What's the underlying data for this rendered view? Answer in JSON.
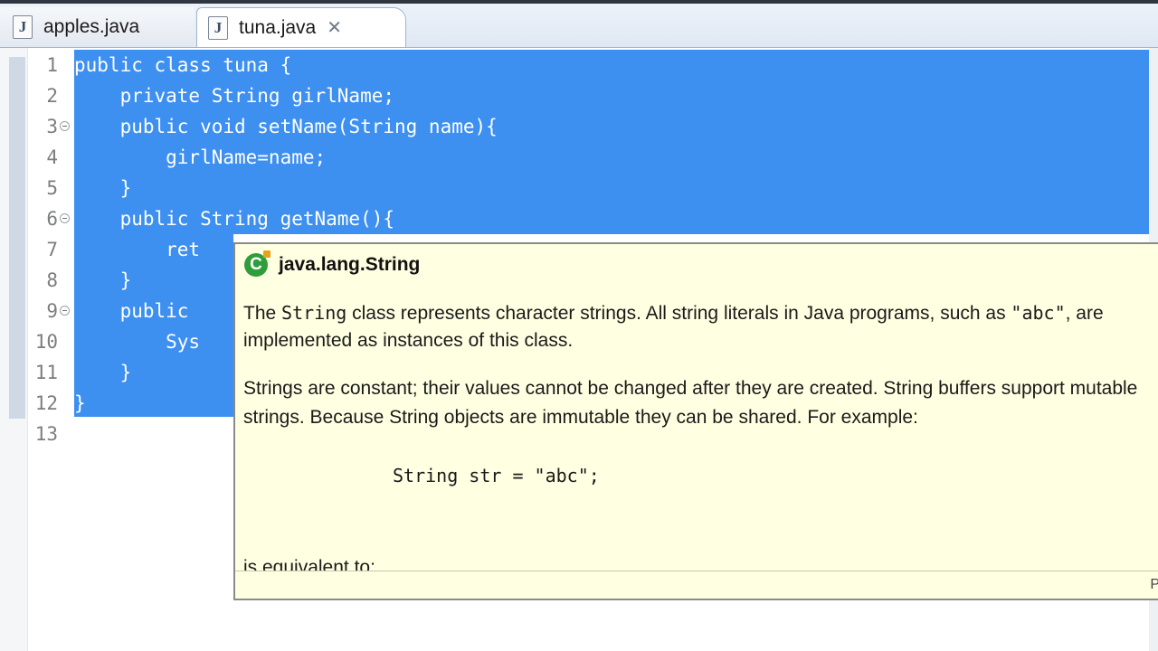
{
  "tabs": [
    {
      "label": "apples.java",
      "icon": "java-file-icon",
      "active": false
    },
    {
      "label": "tuna.java",
      "icon": "java-file-icon",
      "active": true,
      "close_icon": "close-icon"
    }
  ],
  "editor": {
    "line_numbers": [
      "1",
      "2",
      "3",
      "4",
      "5",
      "6",
      "7",
      "8",
      "9",
      "10",
      "11",
      "12",
      "13"
    ],
    "code_lines": [
      "public class tuna {",
      "    private String girlName;",
      "    public void setName(String name){",
      "        girlName=name;",
      "    }",
      "    public String getName(){",
      "        ret",
      "    }",
      "    public",
      "        Sys",
      "    }",
      "}",
      ""
    ],
    "folded_lines": [
      "3",
      "6",
      "9"
    ],
    "selection_color": "#3d8ff0"
  },
  "hover": {
    "title": "java.lang.String",
    "icon": "class-icon",
    "p1_a": "The ",
    "p1_code": "String",
    "p1_b": " class represents character strings. All string literals in Java programs, such as ",
    "p1_code2": "\"abc\"",
    "p1_c": ", are",
    "p1_line2": "implemented as instances of this class.",
    "p2_line1": "Strings are constant; their values cannot be changed after they are created. String buffers support mutable",
    "p2_line2": "strings. Because String objects are immutable they can be shared. For example:",
    "example": "String str = \"abc\";",
    "p3": "is equivalent to:",
    "footer_label": "P"
  }
}
